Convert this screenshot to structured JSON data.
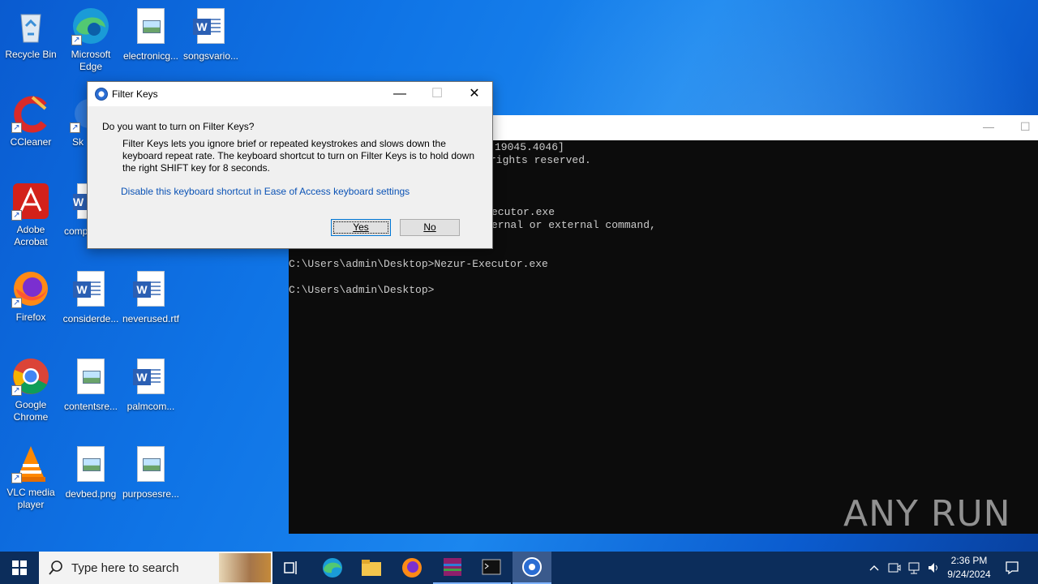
{
  "desktop_icons": [
    {
      "label": "Recycle Bin"
    },
    {
      "label": "Microsoft Edge"
    },
    {
      "label": "electronicg..."
    },
    {
      "label": "songsvario..."
    },
    {
      "label": "CCleaner"
    },
    {
      "label": "Sk"
    },
    {
      "label": "Adobe Acrobat"
    },
    {
      "label": "comp"
    },
    {
      "label": "Firefox"
    },
    {
      "label": "considerde..."
    },
    {
      "label": "neverused.rtf"
    },
    {
      "label": "Google Chrome"
    },
    {
      "label": "contentsre..."
    },
    {
      "label": "palmcom..."
    },
    {
      "label": "VLC media player"
    },
    {
      "label": "devbed.png"
    },
    {
      "label": "purposesre..."
    }
  ],
  "cmd": {
    "lines_partial": [
      "19045.4046]",
      "rights reserved.",
      "",
      "",
      "ecutor.exe",
      "ernal or external command,"
    ],
    "prompt1": "C:\\Users\\admin\\Desktop>Nezur-Executor.exe",
    "prompt2": "C:\\Users\\admin\\Desktop>"
  },
  "dialog": {
    "title": "Filter Keys",
    "question": "Do you want to turn on Filter Keys?",
    "description": "Filter Keys lets you ignore brief or repeated keystrokes and slows down the keyboard repeat rate.  The keyboard shortcut to turn on Filter Keys is to hold down the right SHIFT key for 8 seconds.",
    "link": "Disable this keyboard shortcut in Ease of Access keyboard settings",
    "yes_label": "Yes",
    "no_label": "No"
  },
  "taskbar": {
    "search_placeholder": "Type here to search",
    "time": "2:36 PM",
    "date": "9/24/2024"
  },
  "watermark": "ANY RUN"
}
